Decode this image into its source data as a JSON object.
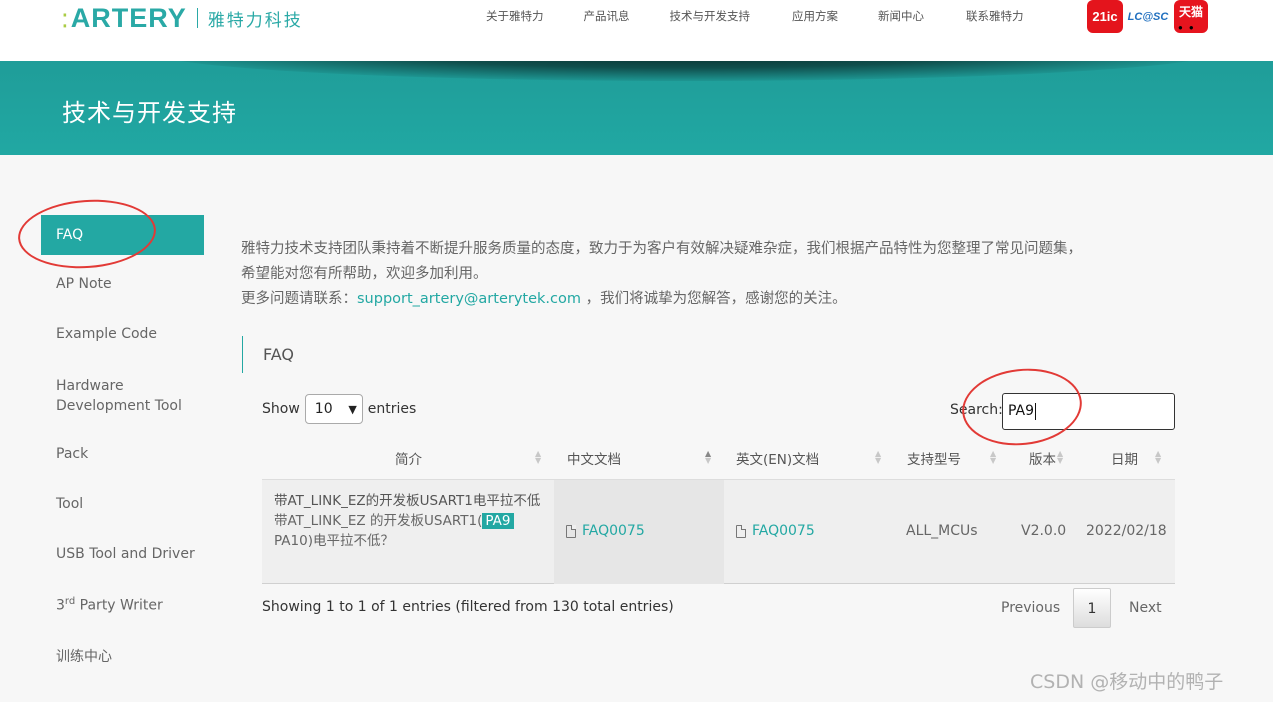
{
  "header": {
    "logo_text": "ARTERY",
    "logo_cn": "雅特力科技",
    "nav": [
      "关于雅特力",
      "产品讯息",
      "技术与开发支持",
      "应用方案",
      "新闻中心",
      "联系雅特力"
    ],
    "partners": [
      "21ic",
      "LC@SC",
      "天猫"
    ]
  },
  "banner": {
    "title": "技术与开发支持"
  },
  "sidebar": {
    "items": [
      {
        "label": "FAQ",
        "active": true
      },
      {
        "label": "AP Note"
      },
      {
        "label": "Example Code"
      },
      {
        "label": "Hardware Development Tool"
      },
      {
        "label": "Pack"
      },
      {
        "label": "Tool"
      },
      {
        "label": "USB Tool and Driver"
      },
      {
        "label_pre": "3",
        "label_sup": "rd",
        "label_post": " Party Writer"
      },
      {
        "label": "训练中心"
      }
    ]
  },
  "intro": {
    "line1": "雅特力技术支持团队秉持着不断提升服务质量的态度，致力于为客户有效解决疑难杂症，我们根据产品特性为您整理了常见问题集，",
    "line2": "希望能对您有所帮助，欢迎多加利用。",
    "line3_pre": "更多问题请联系：",
    "email": "support_artery@arterytek.com",
    "line3_post": " ，我们将诚挚为您解答，感谢您的关注。"
  },
  "section_title": "FAQ",
  "length": {
    "show": "Show",
    "value": "10",
    "entries": "entries"
  },
  "search": {
    "label": "Search:",
    "value": "PA9"
  },
  "table": {
    "columns": [
      "简介",
      "中文文档",
      "英文(EN)文档",
      "支持型号",
      "版本",
      "日期"
    ],
    "rows": [
      {
        "brief_title": "带AT_LINK_EZ的开发板USART1电平拉不低",
        "brief_pre": "带AT_LINK_EZ 的开发板USART1(",
        "brief_hl": "PA9",
        "brief_post": "PA10)电平拉不低？",
        "cn_doc": "FAQ0075",
        "en_doc": "FAQ0075",
        "model": "ALL_MCUs",
        "version": "V2.0.0",
        "date": "2022/02/18"
      }
    ]
  },
  "footer_info": "Showing 1 to 1 of 1 entries (filtered from 130 total entries)",
  "pagination": {
    "previous": "Previous",
    "current": "1",
    "next": "Next"
  },
  "watermark": "CSDN @移动中的鸭子",
  "colors": {
    "accent": "#23a8a3",
    "annotation": "#e23a36"
  }
}
